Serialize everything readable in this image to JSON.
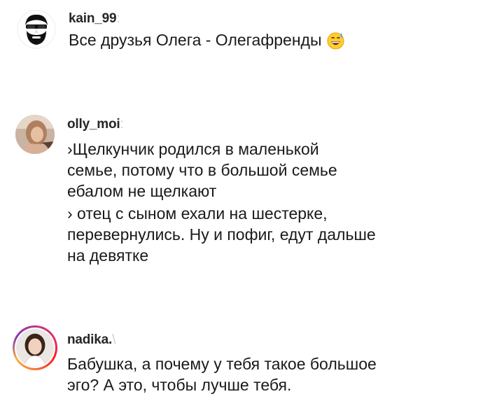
{
  "comments": [
    {
      "username": "kain_99",
      "lines": [
        "Все друзья Олега - Олегафренды"
      ],
      "emoji": "grinning-sweat-emoji"
    },
    {
      "username": "olly_moi",
      "paragraphs": [
        [
          "›Щелкунчик родился в маленькой",
          "семье, потому что в большой семье",
          "ебалом не щелкают"
        ],
        [
          "› отец с сыном ехали на шестерке,",
          "перевернулись. Ну и пофиг, едут дальше",
          "на девятке"
        ]
      ]
    },
    {
      "username": "nadika.",
      "lines": [
        "Бабушка, а почему у тебя такое большое",
        "эго? А это, чтобы лучше тебя."
      ],
      "has_story_ring": true
    }
  ]
}
